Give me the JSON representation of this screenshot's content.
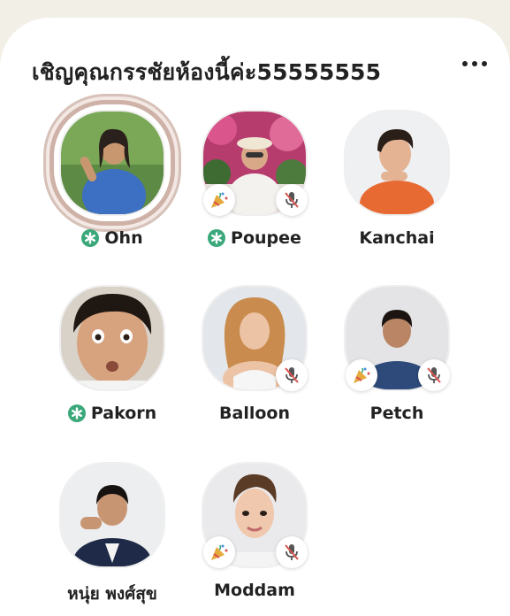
{
  "room": {
    "title": "เชิญคุณกรรชัยห้องนี้ค่ะ55555555",
    "more_icon": "more-horizontal-icon"
  },
  "colors": {
    "moderator_badge": "#3aa87a",
    "mute_slash": "#d9534f",
    "ring": "#cfb2a7"
  },
  "speakers": [
    {
      "name": "Ohn",
      "moderator": true,
      "speaking": true,
      "muted": false,
      "new_user": false
    },
    {
      "name": "Poupee",
      "moderator": true,
      "speaking": false,
      "muted": true,
      "new_user": true
    },
    {
      "name": "Kanchai",
      "moderator": false,
      "speaking": false,
      "muted": false,
      "new_user": false
    },
    {
      "name": "Pakorn",
      "moderator": true,
      "speaking": false,
      "muted": false,
      "new_user": false
    },
    {
      "name": "Balloon",
      "moderator": false,
      "speaking": false,
      "muted": true,
      "new_user": false
    },
    {
      "name": "Petch",
      "moderator": false,
      "speaking": false,
      "muted": true,
      "new_user": true
    },
    {
      "name": "หนุ่ย พงศ์สุข",
      "moderator": false,
      "speaking": false,
      "muted": false,
      "new_user": false
    },
    {
      "name": "Moddam",
      "moderator": false,
      "speaking": false,
      "muted": true,
      "new_user": true
    }
  ]
}
